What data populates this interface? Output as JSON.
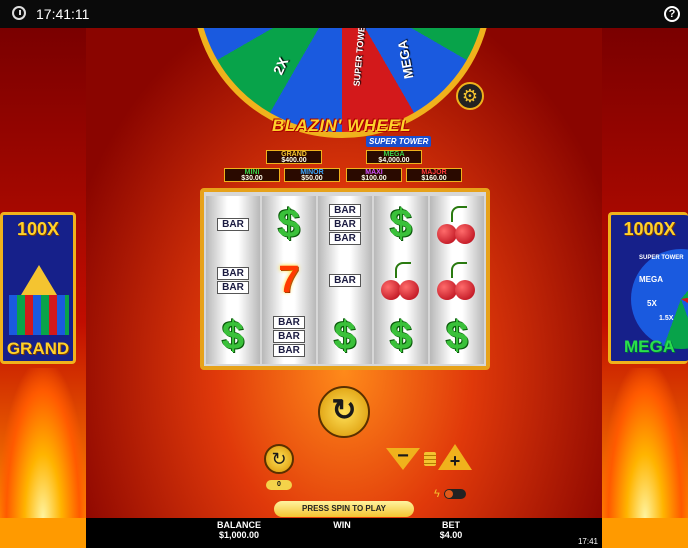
{
  "status_bar": {
    "time": "17:41:11",
    "help": "?"
  },
  "wheel": {
    "segments": [
      "2X",
      "SUPER TOWER",
      "MEGA"
    ]
  },
  "logo": {
    "title": "BLAZIN' WHEEL",
    "subtitle": "SUPER TOWER"
  },
  "jackpots": {
    "grand": {
      "name": "GRAND",
      "value": "$400.00"
    },
    "mega": {
      "name": "MEGA",
      "value": "$4,000.00"
    },
    "mini": {
      "name": "MINI",
      "value": "$30.00"
    },
    "minor": {
      "name": "MINOR",
      "value": "$50.00"
    },
    "maxi": {
      "name": "MAXI",
      "value": "$100.00"
    },
    "major": {
      "name": "MAJOR",
      "value": "$160.00"
    }
  },
  "reels": {
    "bar": "BAR",
    "seven": "7",
    "dollar": "$"
  },
  "left_panel": {
    "multiplier": "100X",
    "label": "GRAND"
  },
  "right_panel": {
    "multiplier": "1000X",
    "label": "MEGA",
    "small": [
      "SUPER TOWER",
      "MEGA",
      "5X",
      "1.5X"
    ]
  },
  "controls": {
    "spin_symbol": "↻",
    "autoplay_symbol": "↻",
    "autoplay_count": "0",
    "bet_minus": "−",
    "bet_plus": "+",
    "bolt": "ϟ",
    "status_message": "PRESS SPIN TO PLAY"
  },
  "footer": {
    "balance_label": "BALANCE",
    "balance_value": "$1,000.00",
    "win_label": "WIN",
    "bet_label": "BET",
    "bet_value": "$4.00",
    "clock": "17:41"
  },
  "colors": {
    "accent_gold": "#f0b21c",
    "background_red": "#c41000"
  }
}
